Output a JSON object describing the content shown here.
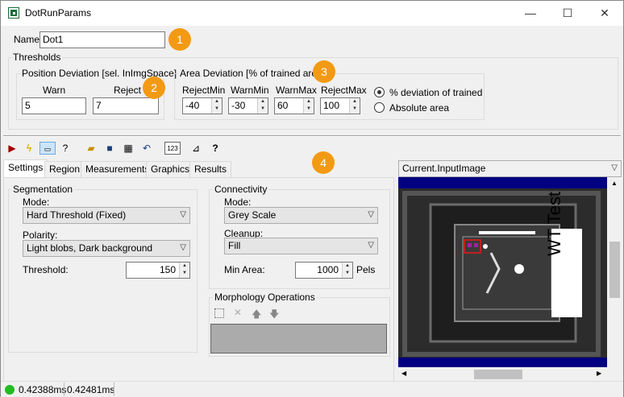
{
  "window": {
    "title": "DotRunParams",
    "minimize": "—",
    "maximize": "☐",
    "close": "✕"
  },
  "name_field": {
    "label": "Name",
    "value": "Dot1"
  },
  "thresholds": {
    "label": "Thresholds",
    "position": {
      "label": "Position Deviation [sel. InImgSpace]",
      "warn_label": "Warn",
      "reject_label": "Reject",
      "warn": "5",
      "reject": "7"
    },
    "area": {
      "label": "Area Deviation [% of trained area]",
      "reject_min_label": "RejectMin",
      "warn_min_label": "WarnMin",
      "warn_max_label": "WarnMax",
      "reject_max_label": "RejectMax",
      "reject_min": "-40",
      "warn_min": "-30",
      "warn_max": "60",
      "reject_max": "100",
      "options": [
        "% deviation of trained",
        "Absolute area"
      ]
    }
  },
  "badges": [
    "1",
    "2",
    "3",
    "4"
  ],
  "tabs": [
    "Settings",
    "Region",
    "Measurements",
    "Graphics",
    "Results"
  ],
  "segmentation": {
    "label": "Segmentation",
    "mode_label": "Mode:",
    "mode": "Hard Threshold (Fixed)",
    "polarity_label": "Polarity:",
    "polarity": "Light blobs, Dark background",
    "threshold_label": "Threshold:",
    "threshold": "150"
  },
  "connectivity": {
    "label": "Connectivity",
    "mode_label": "Mode:",
    "mode": "Grey Scale",
    "cleanup_label": "Cleanup:",
    "cleanup": "Fill",
    "min_area_label": "Min Area:",
    "min_area": "1000",
    "min_area_unit": "Pels"
  },
  "morphology": {
    "label": "Morphology Operations"
  },
  "image_panel": {
    "selector": "Current.InputImage",
    "overlay_text": "WT Test"
  },
  "status": {
    "time1": "0.42388ms",
    "time2": "0.42481ms"
  },
  "colors": {
    "badge": "#f39a14",
    "accent": "#1c6b3a",
    "status_ok": "#22bb22"
  }
}
